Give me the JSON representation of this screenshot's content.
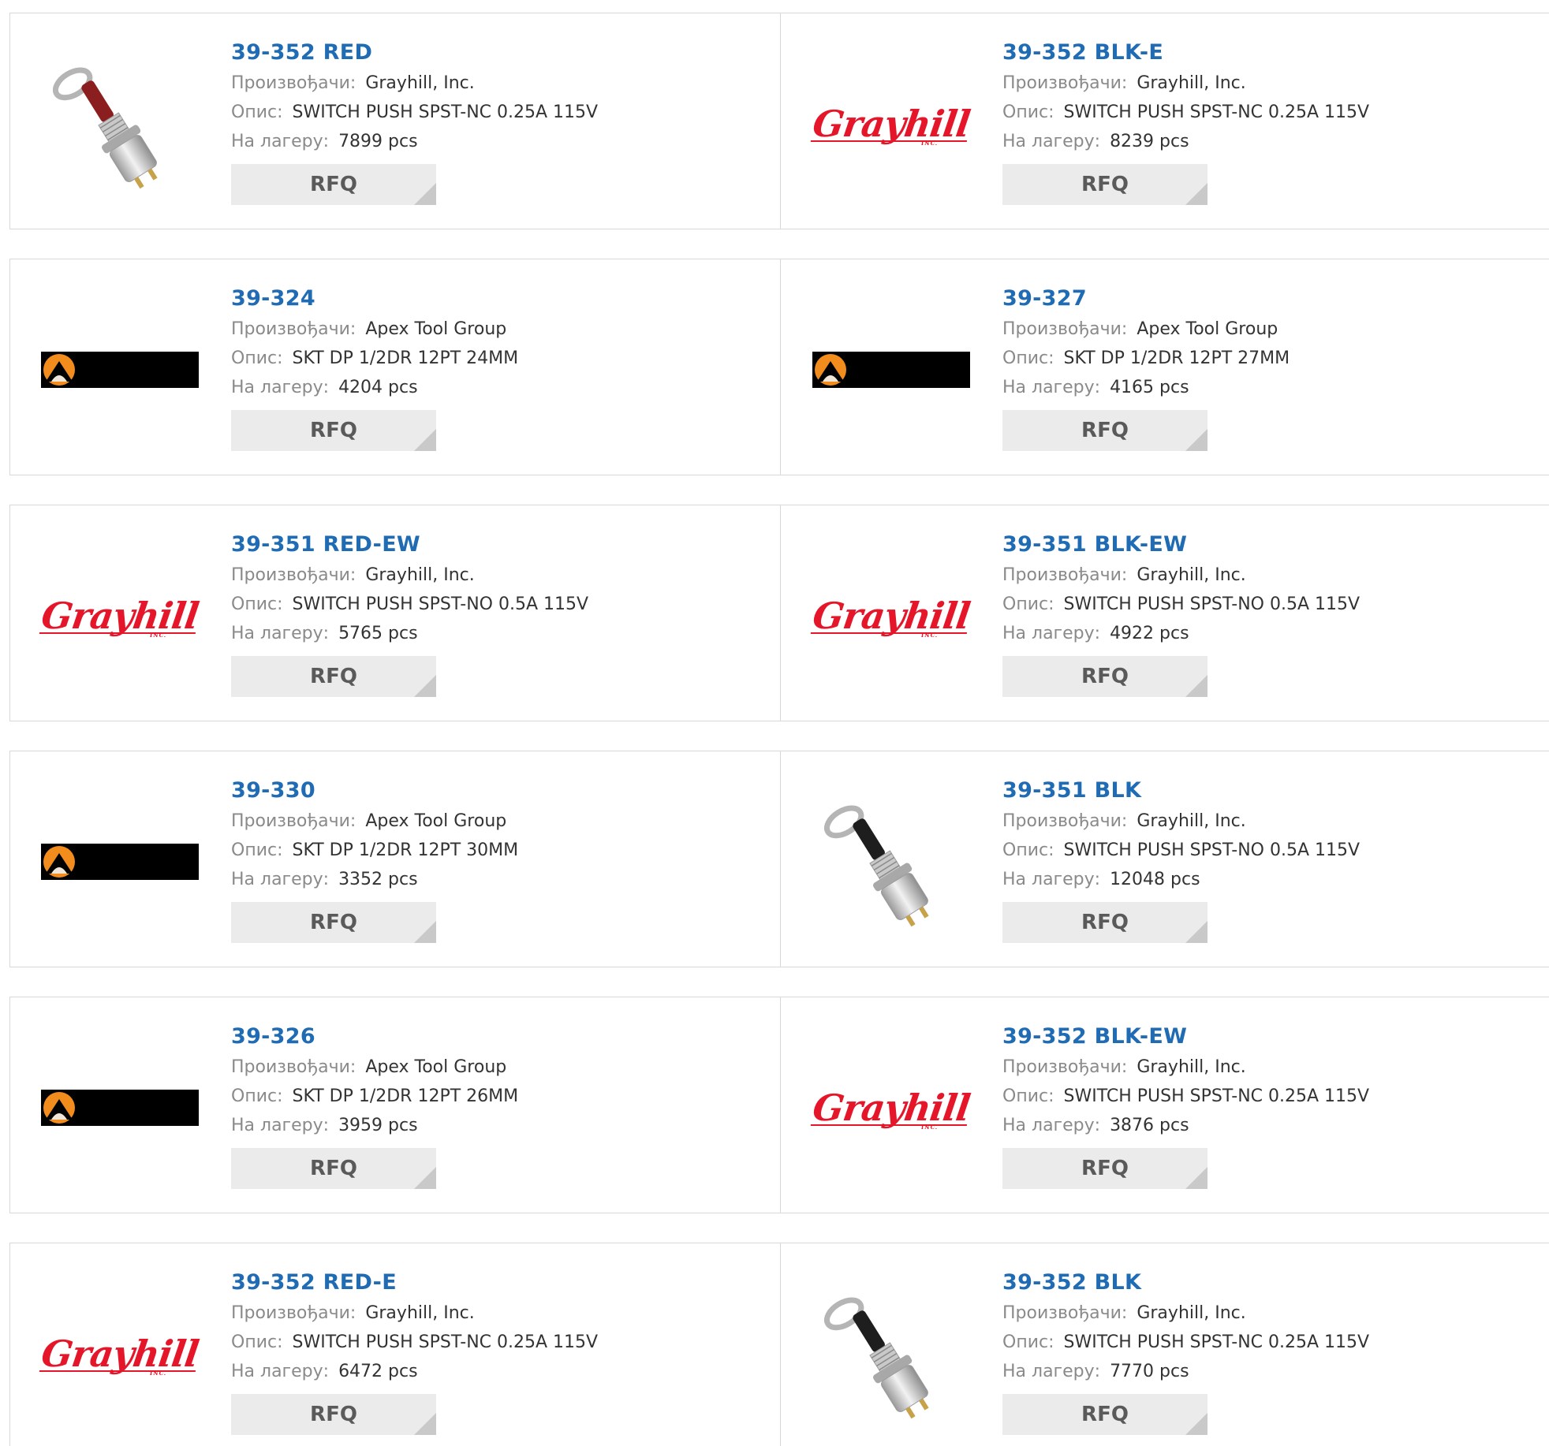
{
  "labels": {
    "manufacturer": "Произвођачи:",
    "description": "Опис:",
    "stock": "На лагеру:",
    "rfq": "RFQ"
  },
  "products": [
    {
      "part": "39-352 RED",
      "manufacturer": "Grayhill, Inc.",
      "description": "SWITCH PUSH SPST-NC 0.25A 115V",
      "stock": "7899 pcs",
      "image": "switch-red-photo"
    },
    {
      "part": "39-352 BLK-E",
      "manufacturer": "Grayhill, Inc.",
      "description": "SWITCH PUSH SPST-NC 0.25A 115V",
      "stock": "8239 pcs",
      "image": "grayhill-logo"
    },
    {
      "part": "39-324",
      "manufacturer": "Apex Tool Group",
      "description": "SKT DP 1/2DR 12PT 24MM",
      "stock": "4204 pcs",
      "image": "apex-logo"
    },
    {
      "part": "39-327",
      "manufacturer": "Apex Tool Group",
      "description": "SKT DP 1/2DR 12PT 27MM",
      "stock": "4165 pcs",
      "image": "apex-logo"
    },
    {
      "part": "39-351 RED-EW",
      "manufacturer": "Grayhill, Inc.",
      "description": "SWITCH PUSH SPST-NO 0.5A 115V",
      "stock": "5765 pcs",
      "image": "grayhill-logo"
    },
    {
      "part": "39-351 BLK-EW",
      "manufacturer": "Grayhill, Inc.",
      "description": "SWITCH PUSH SPST-NO 0.5A 115V",
      "stock": "4922 pcs",
      "image": "grayhill-logo"
    },
    {
      "part": "39-330",
      "manufacturer": "Apex Tool Group",
      "description": "SKT DP 1/2DR 12PT 30MM",
      "stock": "3352 pcs",
      "image": "apex-logo"
    },
    {
      "part": "39-351 BLK",
      "manufacturer": "Grayhill, Inc.",
      "description": "SWITCH PUSH SPST-NO 0.5A 115V",
      "stock": "12048 pcs",
      "image": "switch-black-photo"
    },
    {
      "part": "39-326",
      "manufacturer": "Apex Tool Group",
      "description": "SKT DP 1/2DR 12PT 26MM",
      "stock": "3959 pcs",
      "image": "apex-logo"
    },
    {
      "part": "39-352 BLK-EW",
      "manufacturer": "Grayhill, Inc.",
      "description": "SWITCH PUSH SPST-NC 0.25A 115V",
      "stock": "3876 pcs",
      "image": "grayhill-logo"
    },
    {
      "part": "39-352 RED-E",
      "manufacturer": "Grayhill, Inc.",
      "description": "SWITCH PUSH SPST-NC 0.25A 115V",
      "stock": "6472 pcs",
      "image": "grayhill-logo"
    },
    {
      "part": "39-352 BLK",
      "manufacturer": "Grayhill, Inc.",
      "description": "SWITCH PUSH SPST-NC 0.25A 115V",
      "stock": "7770 pcs",
      "image": "switch-black-photo"
    }
  ],
  "logos": {
    "grayhill": {
      "text": "Grayhill",
      "inc": "INC."
    }
  },
  "colors": {
    "title": "#1f6cb5",
    "grayhill_red": "#e5162a",
    "switch_red": "#8b1e1e",
    "switch_black": "#1e1e1e"
  }
}
